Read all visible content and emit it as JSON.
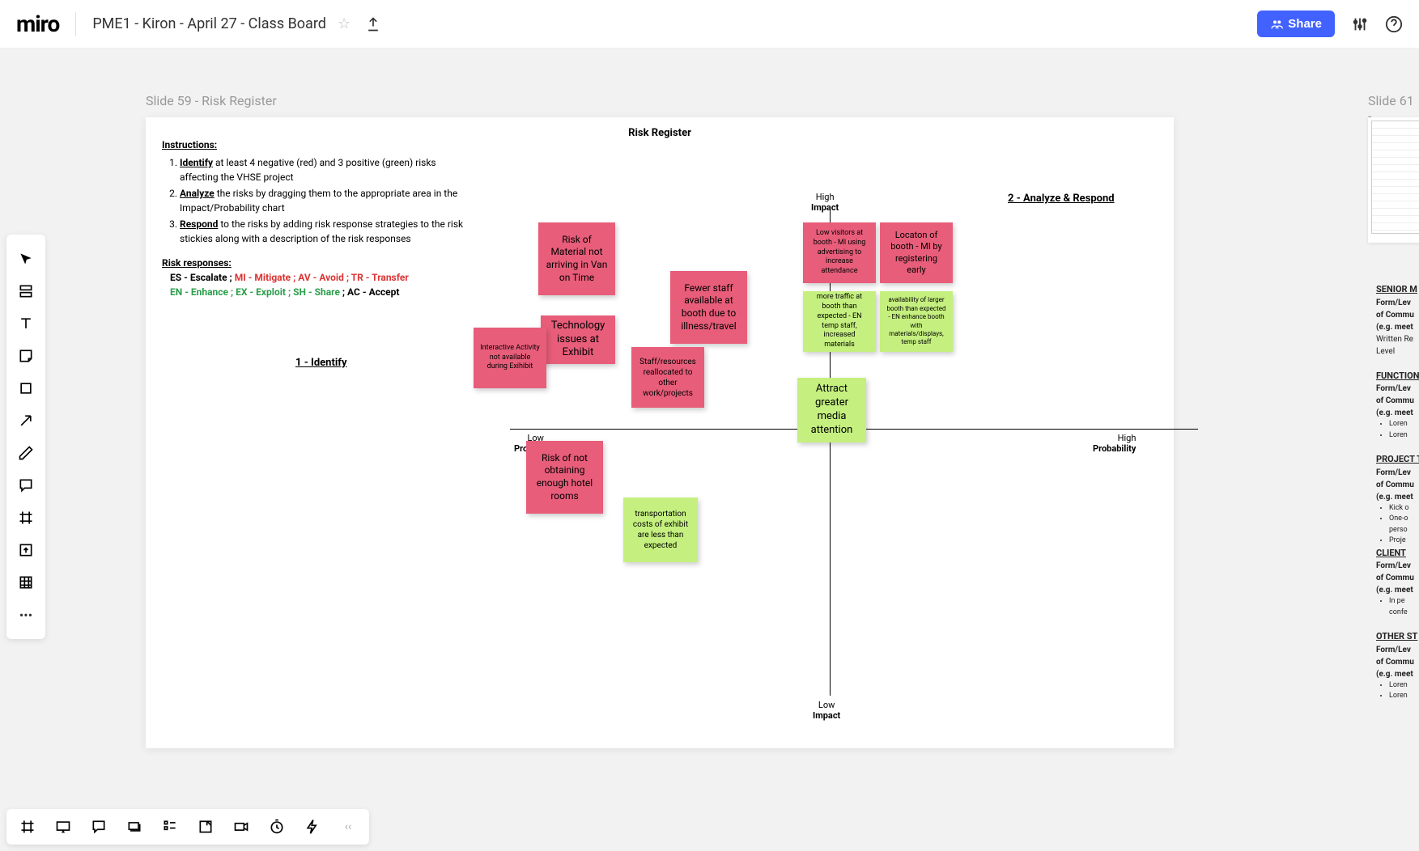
{
  "header": {
    "logo": "miro",
    "board_title": "PME1 - Kiron - April 27 - Class Board",
    "share_label": "Share"
  },
  "slides": {
    "s59": "Slide 59 - Risk Register",
    "s61": "Slide 61 -"
  },
  "frame": {
    "title": "Risk Register",
    "instructions_h": "Instructions:",
    "li1a": "Identify",
    "li1b": " at least 4 negative (red) and 3 positive (green) risks affecting the VHSE project",
    "li2a": "Analyze",
    "li2b": " the risks by dragging them to the appropriate area in the Impact/Probability chart",
    "li3a": "Respond",
    "li3b": " to the risks by adding risk response strategies to the risk stickies along with a description of the risk responses",
    "responses_h": "Risk responses:",
    "resp_es": "ES - Escalate ; ",
    "resp_red": "MI - Mitigate ; AV - Avoid ; TR - Transfer",
    "resp_green": "EN - Enhance ; EX - Exploit ; SH - Share",
    "resp_ac": " ; AC - Accept",
    "identify": "1 - Identify",
    "analyze": "2 - Analyze & Respond",
    "axis": {
      "high_impact_1": "High",
      "high_impact_2": "Impact",
      "low_impact_1": "Low",
      "low_impact_2": "Impact",
      "low_prob_1": "Low",
      "low_prob_2": "Probability",
      "high_prob_1": "High",
      "high_prob_2": "Probability"
    },
    "stickies": {
      "s1": "Risk of Material not arriving in Van on Time",
      "s2": "Technology issues at Exhibit",
      "s3": "Interactive Activity not available during Exihibit",
      "s4": "Fewer staff available at booth due to illness/travel",
      "s5": "Staff/resources reallocated to other work/projects",
      "s6": "Low visitors at booth - MI using advertising to increase attendance",
      "s7": "Locaton of booth - MI by registering early",
      "s8": "more traffic at booth than expected - EN temp staff, increased materials",
      "s9": "availability of larger booth than expected - EN enhance booth with materials/displays, temp staff",
      "s10": "Attract greater media attention",
      "s11": "Risk of not obtaining enough hotel rooms",
      "s12": "transportation costs of exhibit are less than expected"
    }
  },
  "next_doc": {
    "senior_h": "SENIOR M",
    "form1": "Form/Lev",
    "form2": "of Commu",
    "form3": "(e.g. meet",
    "wr1": "Written Re",
    "wr2": "Level",
    "func_h": "FUNCTION",
    "lorem": "Loren",
    "proj_h": "PROJECT T",
    "kick": "Kick o",
    "one": "One-o",
    "pers": "perso",
    "proj": "Proje",
    "client_h": "CLIENT",
    "inp": "In pe",
    "conf": "confe",
    "other_h": "OTHER ST"
  }
}
